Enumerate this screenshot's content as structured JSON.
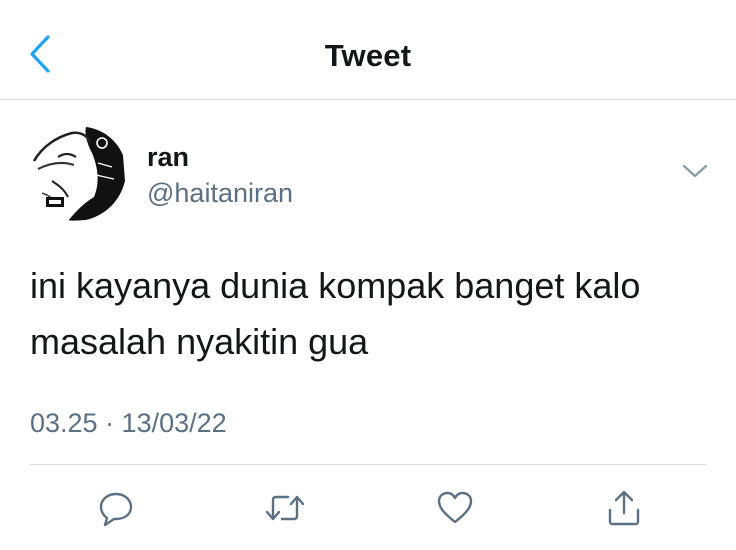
{
  "header": {
    "title": "Tweet",
    "back_icon": "chevron-left-icon"
  },
  "tweet": {
    "author": {
      "display_name": "ran",
      "handle": "@haitaniran"
    },
    "text": "ini kayanya dunia kompak banget kalo masalah nyakitin gua",
    "timestamp": "03.25 · 13/03/22"
  },
  "actions": [
    "reply-icon",
    "retweet-icon",
    "like-icon",
    "share-icon"
  ],
  "colors": {
    "accent": "#1da1f2",
    "text": "#14171a",
    "secondary_text": "#5b7083",
    "divider": "#d8dde1"
  }
}
